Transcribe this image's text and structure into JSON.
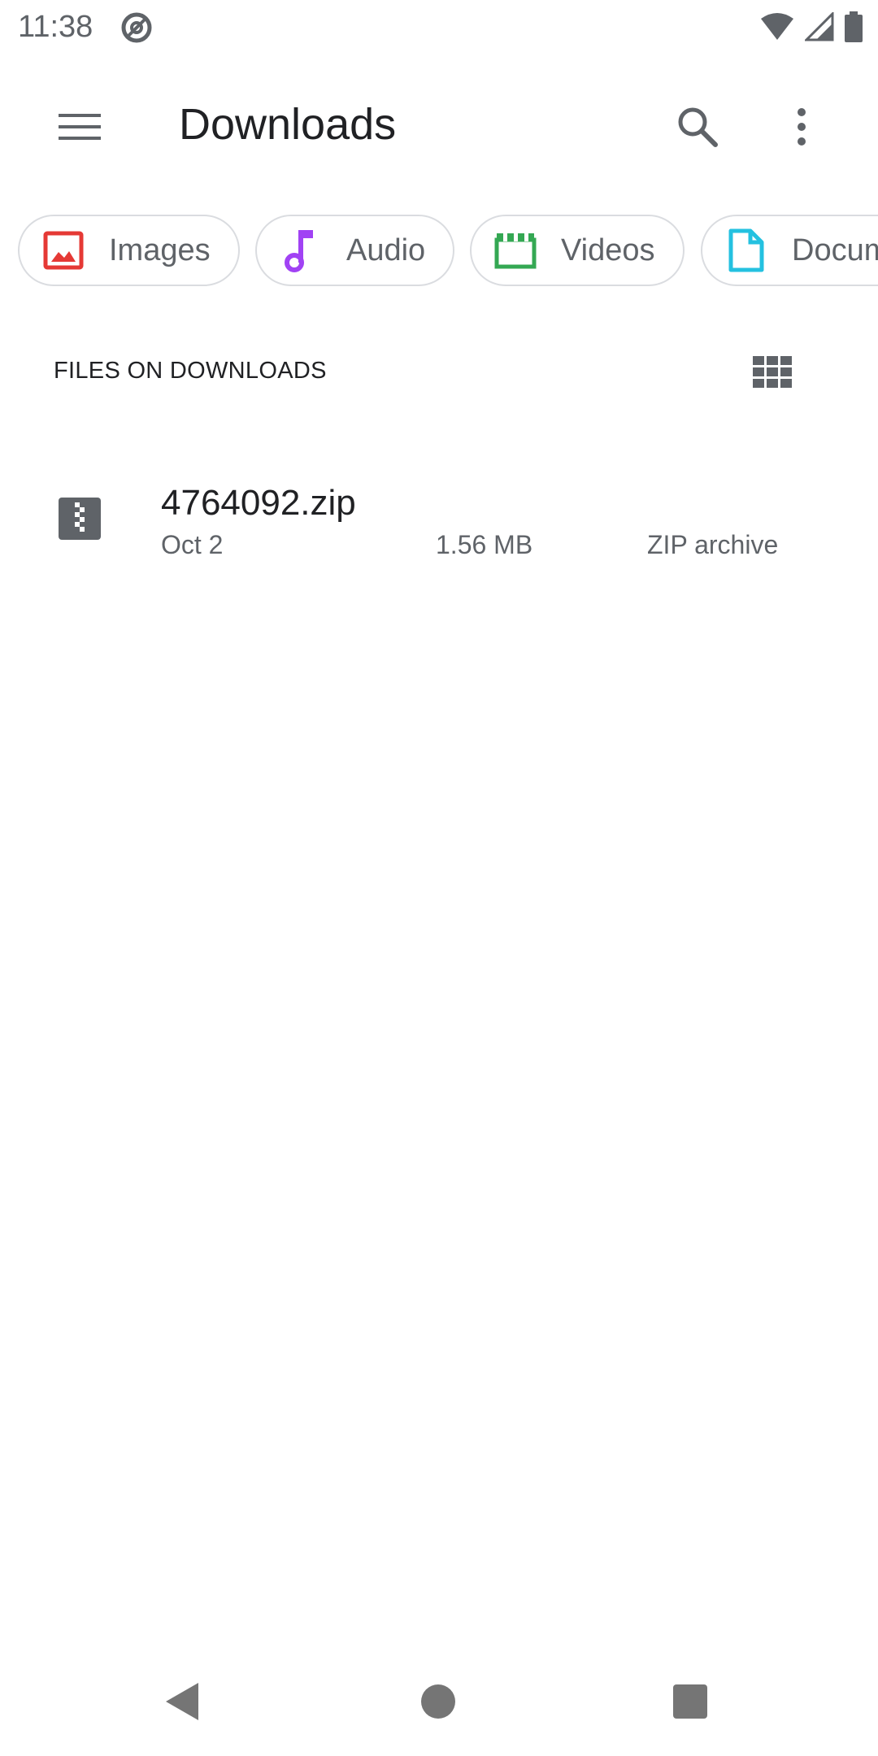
{
  "status_bar": {
    "time": "11:38",
    "icons": [
      "at-sign-icon",
      "wifi-icon",
      "cell-signal-icon",
      "battery-icon"
    ]
  },
  "toolbar": {
    "title": "Downloads",
    "icons": [
      "menu-icon",
      "search-icon",
      "more-vert-icon"
    ]
  },
  "chips": [
    {
      "label": "Images",
      "icon": "image-icon",
      "color": "#e53935"
    },
    {
      "label": "Audio",
      "icon": "music-note-icon",
      "color": "#a142f4"
    },
    {
      "label": "Videos",
      "icon": "movie-clapper-icon",
      "color": "#34a853"
    },
    {
      "label": "Docum",
      "icon": "document-icon",
      "color": "#24c1e0"
    }
  ],
  "section": {
    "header": "FILES ON DOWNLOADS",
    "view_toggle_icon": "grid-view-icon"
  },
  "files": [
    {
      "name": "4764092.zip",
      "date": "Oct 2",
      "size": "1.56 MB",
      "type": "ZIP archive",
      "icon": "zip-file-icon"
    }
  ],
  "nav_bar": {
    "icons": [
      "back-icon",
      "home-icon",
      "recents-icon"
    ]
  },
  "colors": {
    "icon_grey": "#5f6368",
    "chip_border": "#dadce0"
  }
}
